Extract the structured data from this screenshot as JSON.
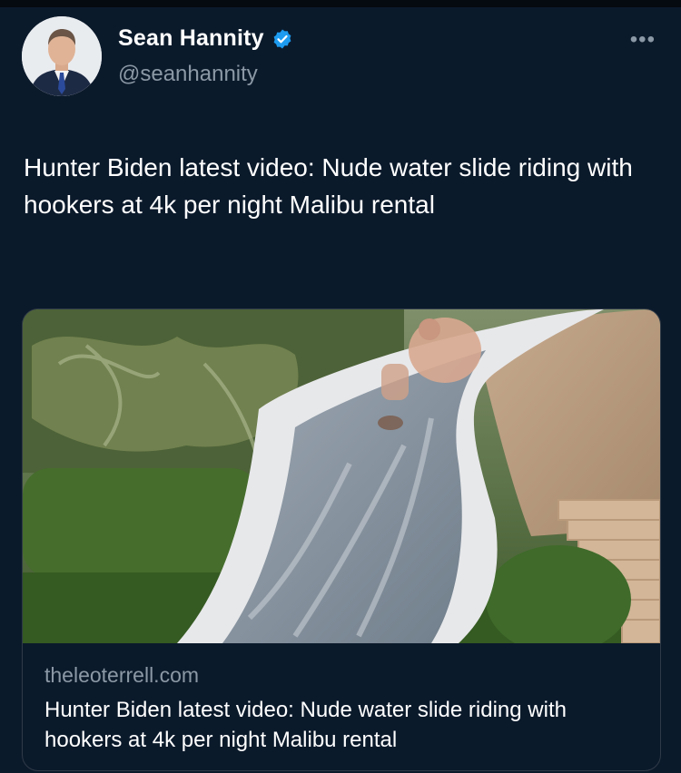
{
  "tweet": {
    "author_name": "Sean Hannity",
    "handle": "@seanhannity",
    "more_label": "•••",
    "text": "Hunter Biden latest video: Nude water slide riding with hookers at 4k per night Malibu rental",
    "verified": true
  },
  "card": {
    "domain": "theleoterrell.com",
    "title": "Hunter Biden latest video: Nude water slide riding with hookers at 4k per night Malibu rental"
  },
  "colors": {
    "background": "#0b1a2b",
    "verified_badge": "#1d9bf0",
    "secondary_text": "#8b98a5",
    "primary_text": "#ffffff"
  },
  "icons": {
    "verified": "verified-badge-icon",
    "more": "more-options-icon"
  }
}
